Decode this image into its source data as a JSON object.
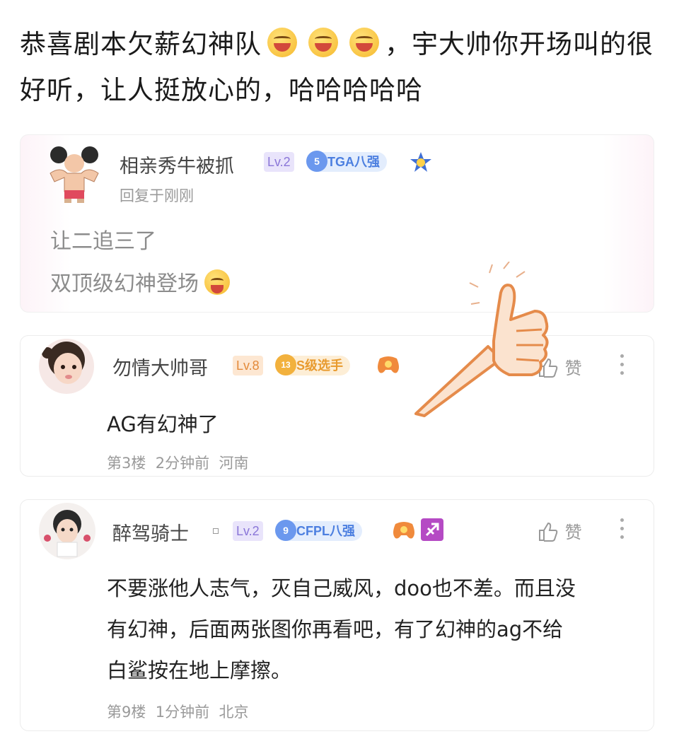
{
  "post": {
    "text_part1": "恭喜剧本欠薪幻神队",
    "text_part2": "，宇大帅你开场叫的很好听，让人挺放心的，哈哈哈哈哈"
  },
  "quoted_reply": {
    "username": "相亲秀牛被抓",
    "level": "Lv.2",
    "rank_num": "5",
    "rank_label": "TGA八强",
    "reply_time": "回复于刚刚",
    "line1": "让二追三了",
    "line2": "双顶级幻神登场"
  },
  "comments": [
    {
      "username": "勿情大帅哥",
      "level": "Lv.8",
      "rank_num": "13",
      "rank_label": "S级选手",
      "body": "AG有幻神了",
      "floor": "第3楼",
      "time": "2分钟前",
      "location": "河南",
      "like_label": "赞"
    },
    {
      "username": "醉驾骑士",
      "level": "Lv.2",
      "rank_num": "9",
      "rank_label": "CFPL八强",
      "body_line1": "不要涨他人志气，灭自己威风，doo也不差。而且没",
      "body_line2": "有幻神，后面两张图你再看吧，有了幻神的ag不给",
      "body_line3": "白鲨按在地上摩擦。",
      "floor": "第9楼",
      "time": "1分钟前",
      "location": "北京",
      "like_label": "赞"
    }
  ],
  "colors": {
    "lv_purple_bg": "#e9e4fb",
    "lv_purple_fg": "#8a76d8",
    "lv_orange_bg": "#fde7d2",
    "lv_orange_fg": "#e38a3a",
    "tga_bg": "#e3edfd",
    "tga_fg": "#4c7fe0",
    "s_bg": "#fdeed6",
    "s_fg": "#e89a2e"
  }
}
